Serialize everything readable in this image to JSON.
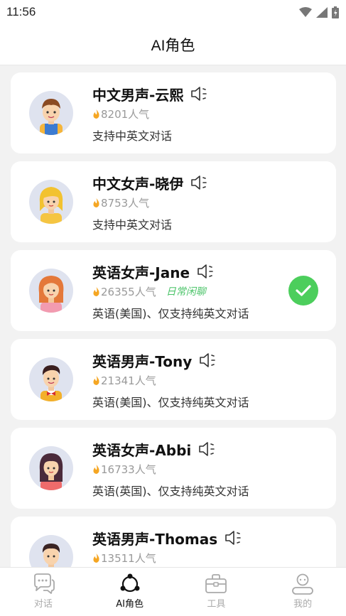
{
  "status_bar": {
    "time": "11:56"
  },
  "header": {
    "title": "AI角色"
  },
  "colors": {
    "accent_green": "#4cce5c",
    "tag_green": "#4cc46a",
    "fire_orange": "#f5a623"
  },
  "characters": [
    {
      "name": "中文男声-云熙",
      "popularity": "8201人气",
      "tag": "",
      "description": "支持中英文对话",
      "selected": false,
      "avatar_icon": "boy-overalls-avatar"
    },
    {
      "name": "中文女声-晓伊",
      "popularity": "8753人气",
      "tag": "",
      "description": "支持中英文对话",
      "selected": false,
      "avatar_icon": "blonde-girl-avatar"
    },
    {
      "name": "英语女声-Jane",
      "popularity": "26355人气",
      "tag": "日常闲聊",
      "description": "英语(美国)、仅支持纯英文对话",
      "selected": true,
      "avatar_icon": "redhead-woman-avatar"
    },
    {
      "name": "英语男声-Tony",
      "popularity": "21341人气",
      "tag": "",
      "description": "英语(美国)、仅支持纯英文对话",
      "selected": false,
      "avatar_icon": "man-bowtie-avatar"
    },
    {
      "name": "英语女声-Abbi",
      "popularity": "16733人气",
      "tag": "",
      "description": "英语(英国)、仅支持纯英文对话",
      "selected": false,
      "avatar_icon": "dark-hair-woman-avatar"
    },
    {
      "name": "英语男声-Thomas",
      "popularity": "13511人气",
      "tag": "",
      "description": "",
      "selected": false,
      "avatar_icon": "man-avatar"
    }
  ],
  "tabs": [
    {
      "label": "对话",
      "icon": "chat-bubbles-icon",
      "active": false
    },
    {
      "label": "AI角色",
      "icon": "ai-nodes-icon",
      "active": true
    },
    {
      "label": "工具",
      "icon": "toolbox-icon",
      "active": false
    },
    {
      "label": "我的",
      "icon": "profile-icon",
      "active": false
    }
  ]
}
